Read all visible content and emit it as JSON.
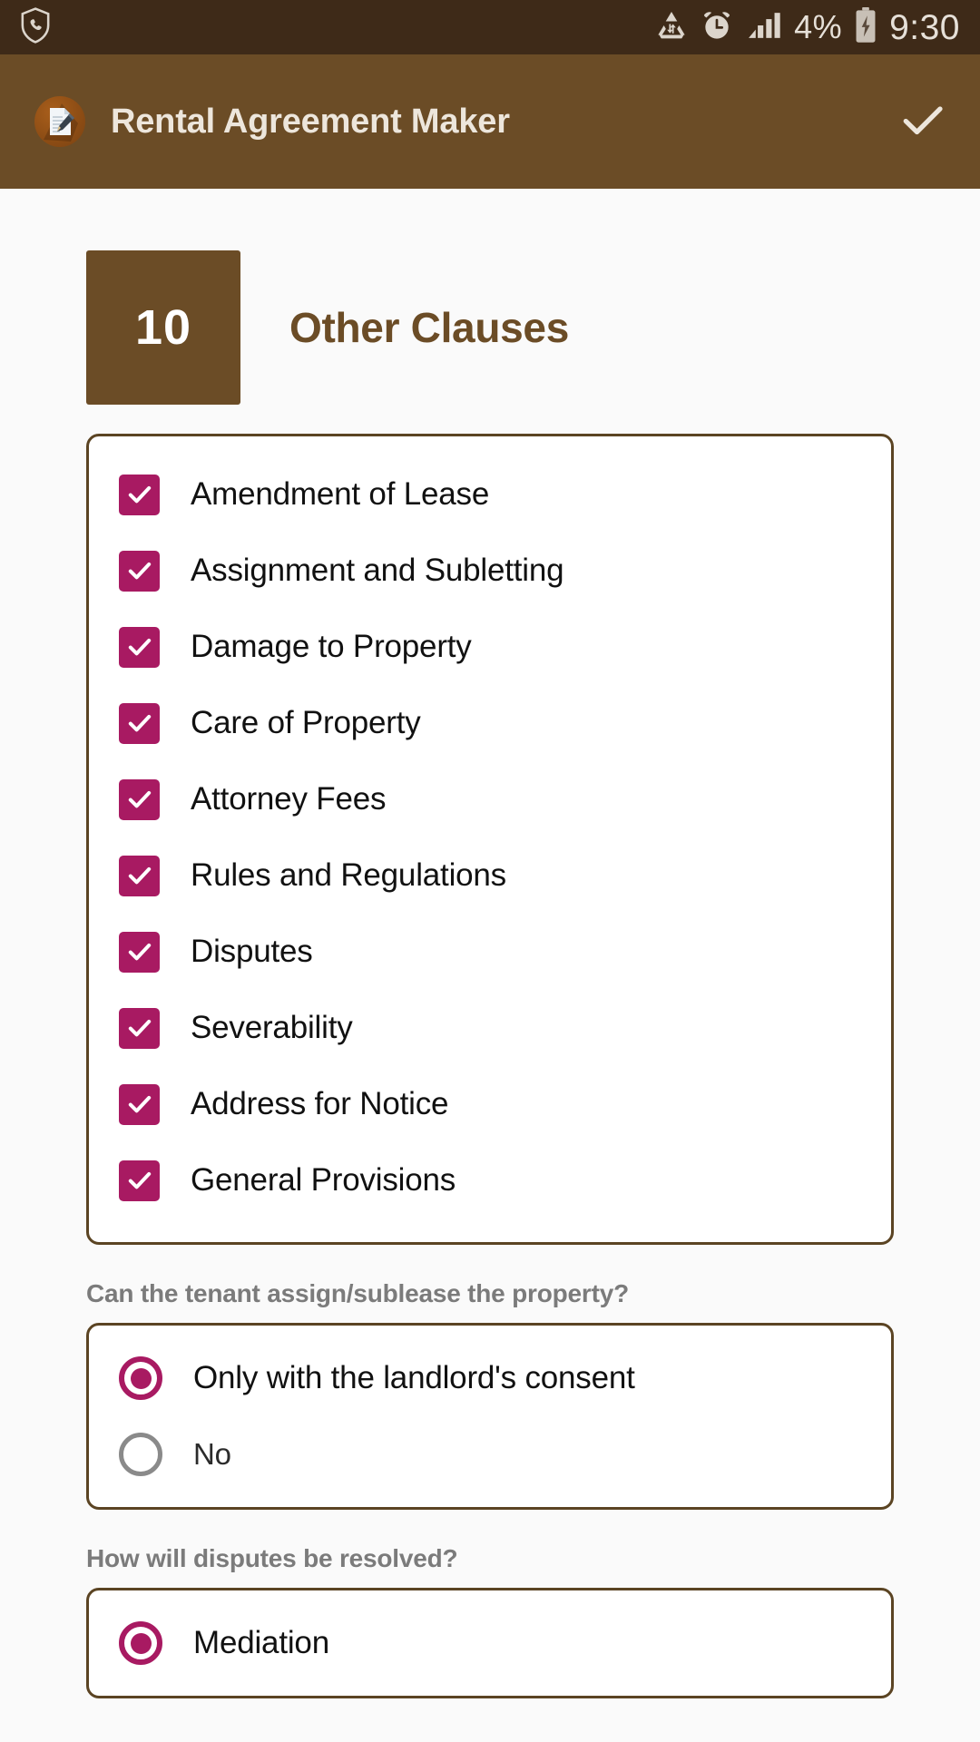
{
  "status_bar": {
    "shield_call_icon": "shield-phone-icon",
    "data_saver_icon": "data-transfer-icon",
    "alarm_icon": "alarm-clock-icon",
    "signal_icon": "signal-bars-icon",
    "battery_percent": "4%",
    "battery_icon": "battery-charging-icon",
    "time": "9:30",
    "background_color": "#3E2A18",
    "text_color": "#E6E0D8"
  },
  "app_bar": {
    "icon": "document-pencil-icon",
    "title": "Rental Agreement Maker",
    "confirm_icon": "check-icon",
    "background_color": "#6B4C26",
    "title_color": "#EDE6DC"
  },
  "section": {
    "number": "10",
    "title": "Other Clauses",
    "badge_color": "#6B4C26",
    "title_color": "#6B4C26"
  },
  "clauses": {
    "accent_color": "#A81A62",
    "items": [
      {
        "label": "Amendment of Lease",
        "checked": true
      },
      {
        "label": "Assignment and Subletting",
        "checked": true
      },
      {
        "label": "Damage to Property",
        "checked": true
      },
      {
        "label": "Care of Property",
        "checked": true
      },
      {
        "label": "Attorney Fees",
        "checked": true
      },
      {
        "label": "Rules and Regulations",
        "checked": true
      },
      {
        "label": "Disputes",
        "checked": true
      },
      {
        "label": "Severability",
        "checked": true
      },
      {
        "label": "Address for Notice",
        "checked": true
      },
      {
        "label": "General Provisions",
        "checked": true
      }
    ]
  },
  "questions": [
    {
      "label": "Can the tenant assign/sublease the property?",
      "options": [
        {
          "label": "Only with the landlord's consent",
          "selected": true
        },
        {
          "label": "No",
          "selected": false
        }
      ]
    },
    {
      "label": "How will disputes be resolved?",
      "options": [
        {
          "label": "Mediation",
          "selected": true
        }
      ]
    }
  ],
  "colors": {
    "page_background": "#FAFAFA",
    "card_background": "#FFFFFF",
    "card_border": "#5B4423",
    "accent": "#A81A62",
    "brown": "#6B4C26",
    "muted_text": "#7B7B7B"
  }
}
